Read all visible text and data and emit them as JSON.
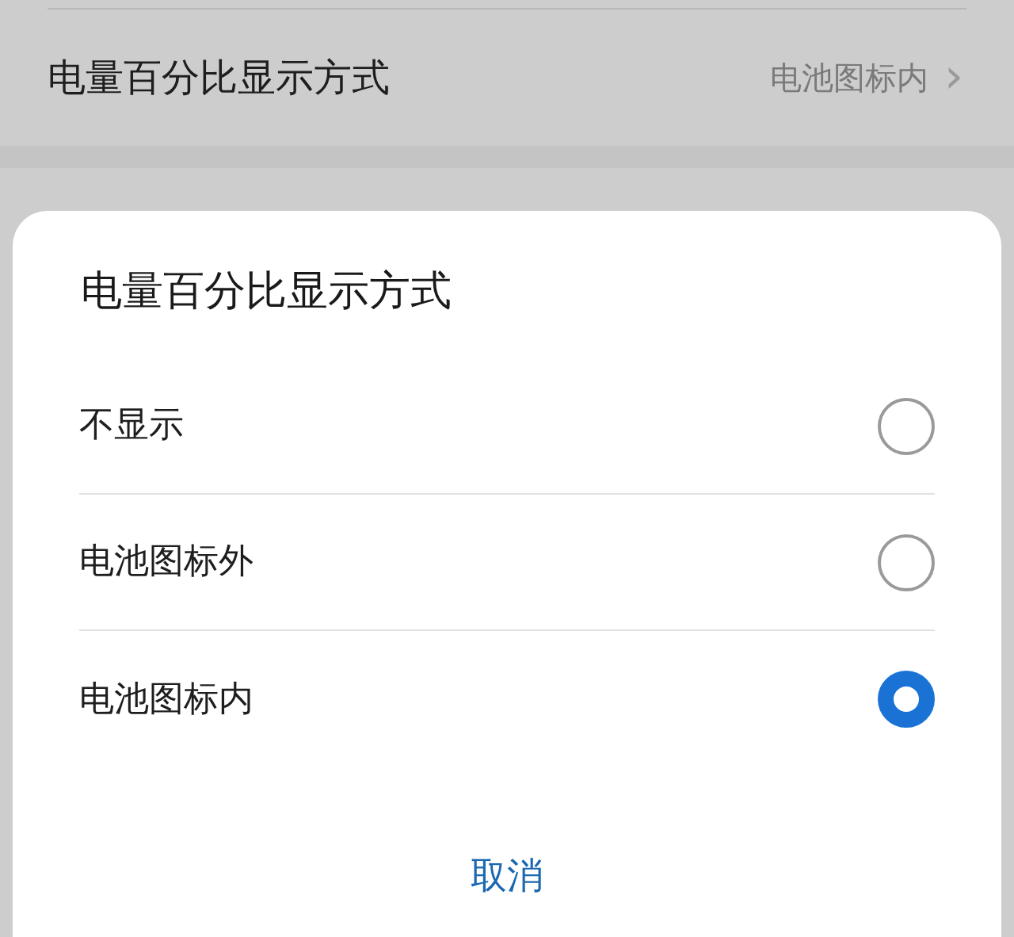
{
  "setting_row": {
    "label": "电量百分比显示方式",
    "value": "电池图标内",
    "chevron": "›"
  },
  "dialog": {
    "title": "电量百分比显示方式",
    "options": [
      {
        "label": "不显示",
        "selected": false
      },
      {
        "label": "电池图标外",
        "selected": false
      },
      {
        "label": "电池图标内",
        "selected": true
      }
    ],
    "cancel": "取消"
  }
}
